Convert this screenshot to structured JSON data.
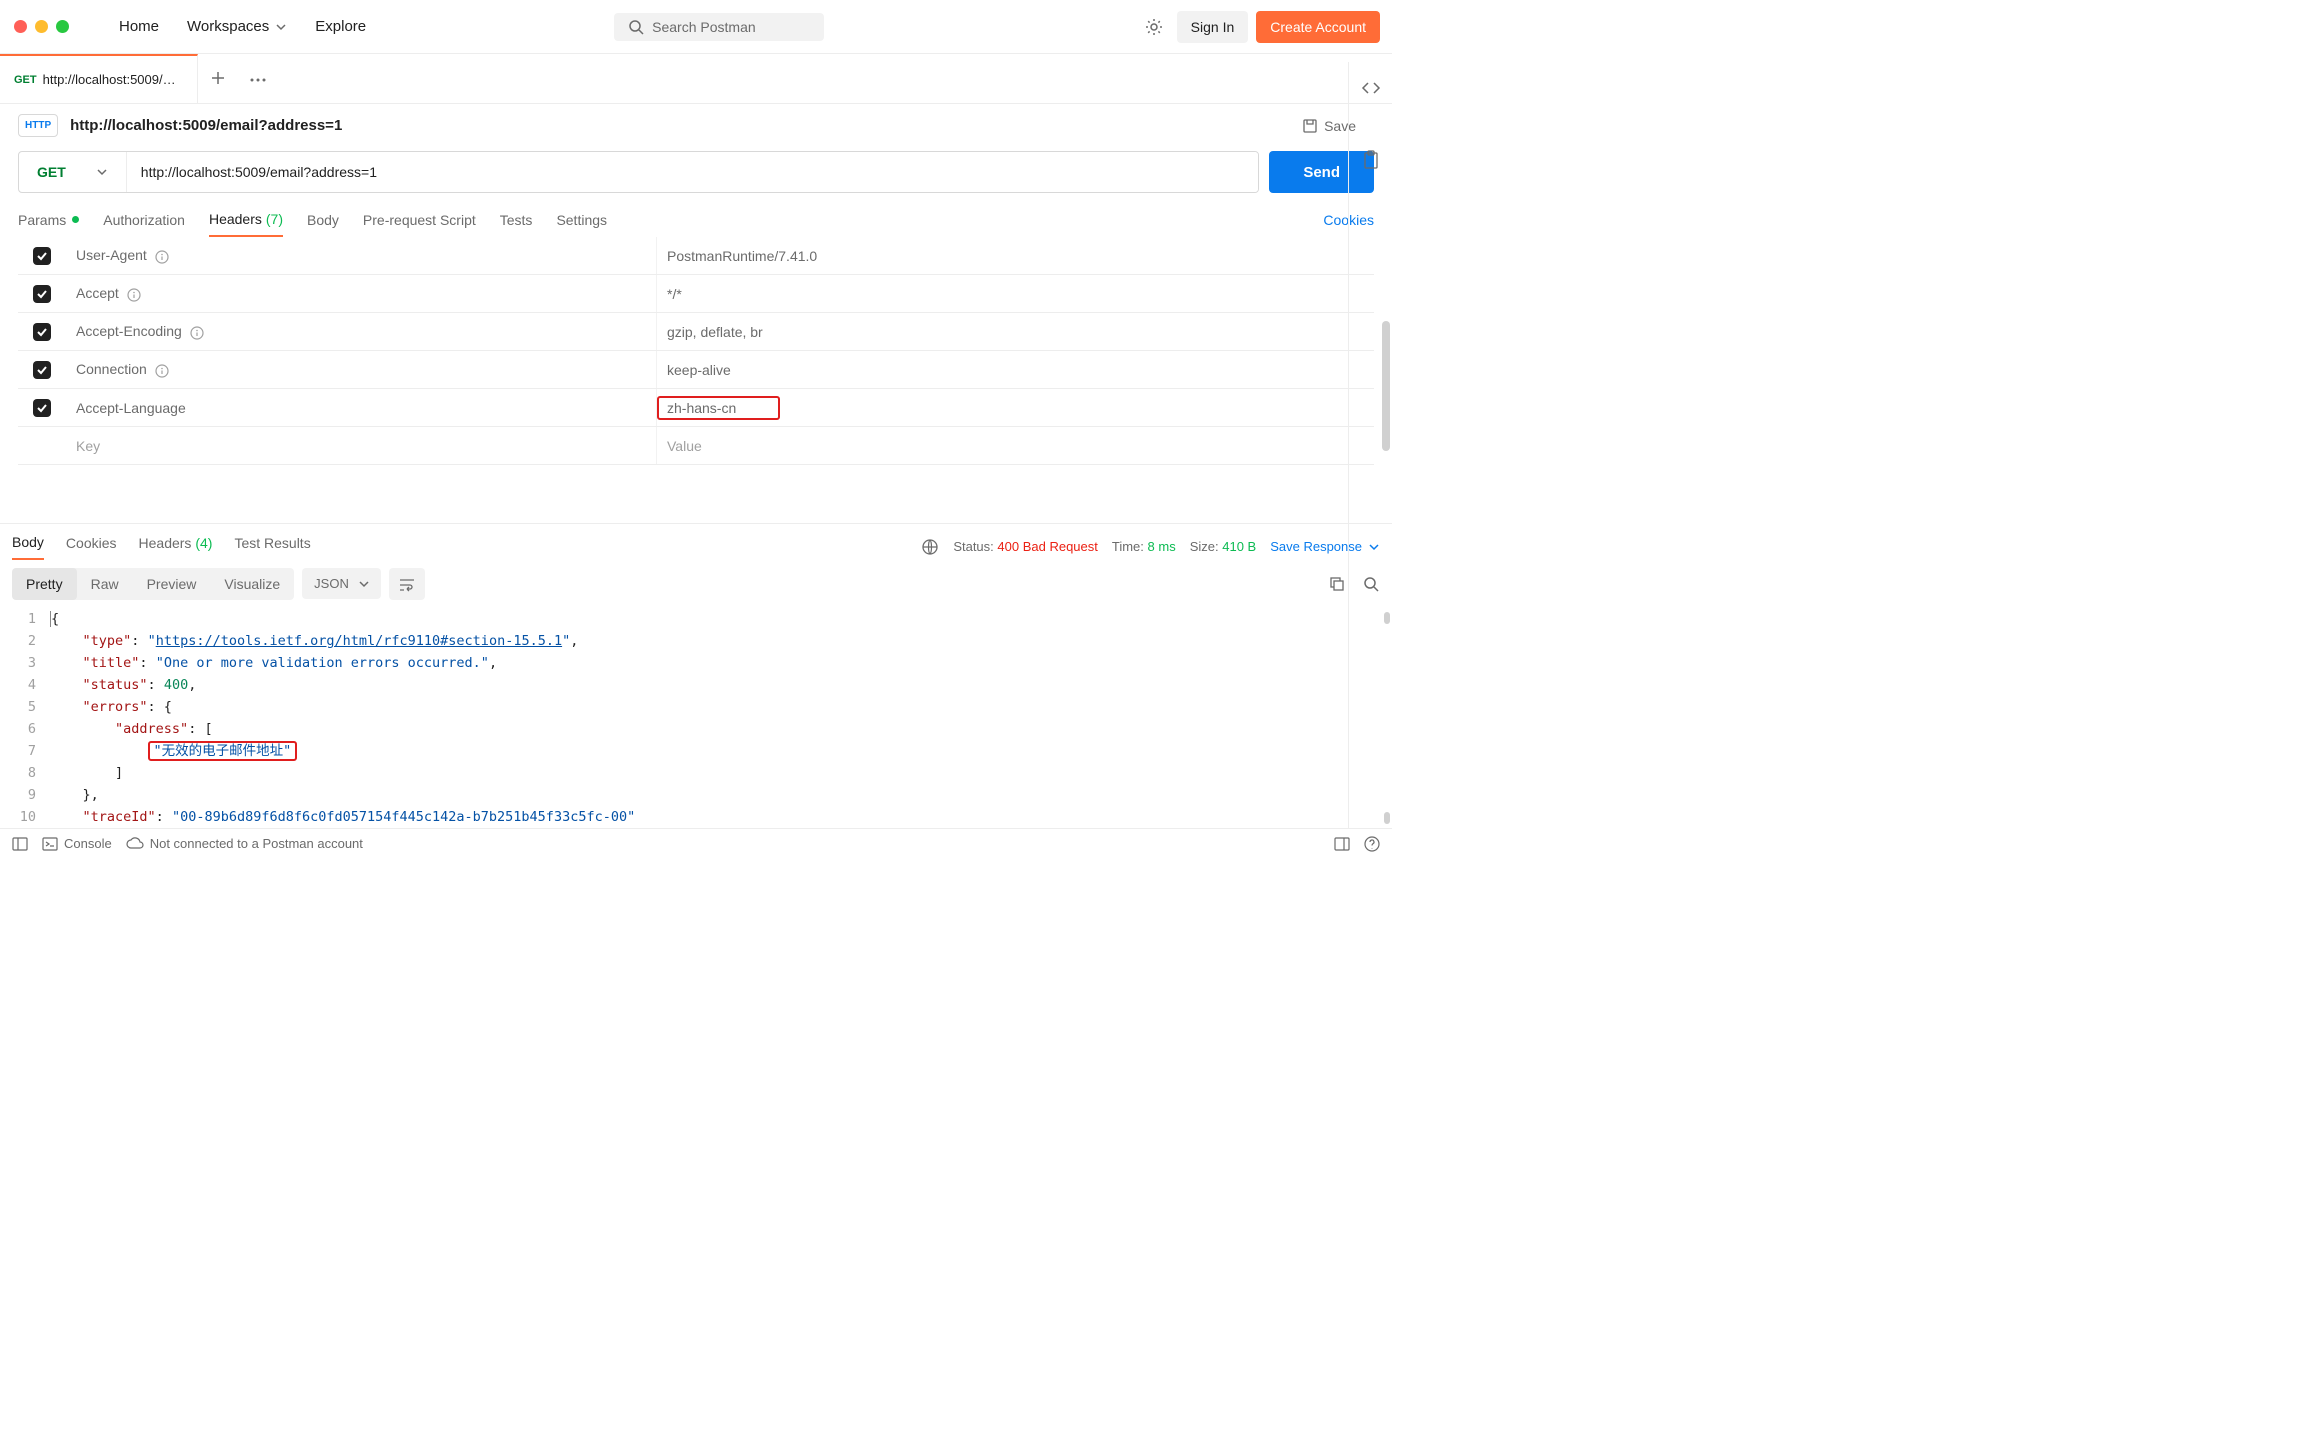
{
  "navbar": {
    "home": "Home",
    "workspaces": "Workspaces",
    "explore": "Explore",
    "search_placeholder": "Search Postman",
    "sign_in": "Sign In",
    "create_account": "Create Account"
  },
  "tab": {
    "method": "GET",
    "label": "http://localhost:5009/ema"
  },
  "request": {
    "title": "http://localhost:5009/email?address=1",
    "save": "Save",
    "method": "GET",
    "url": "http://localhost:5009/email?address=1",
    "send": "Send"
  },
  "req_tabs": {
    "params": "Params",
    "authorization": "Authorization",
    "headers": "Headers",
    "headers_count": "(7)",
    "body": "Body",
    "prerequest": "Pre-request Script",
    "tests": "Tests",
    "settings": "Settings",
    "cookies": "Cookies"
  },
  "headers": [
    {
      "key": "User-Agent",
      "value": "PostmanRuntime/7.41.0",
      "info": true
    },
    {
      "key": "Accept",
      "value": "*/*",
      "info": true
    },
    {
      "key": "Accept-Encoding",
      "value": "gzip, deflate, br",
      "info": true
    },
    {
      "key": "Connection",
      "value": "keep-alive",
      "info": true
    },
    {
      "key": "Accept-Language",
      "value": "zh-hans-cn",
      "info": false,
      "highlight": true
    }
  ],
  "header_placeholder": {
    "key": "Key",
    "value": "Value"
  },
  "response_tabs": {
    "body": "Body",
    "cookies": "Cookies",
    "headers": "Headers",
    "headers_count": "(4)",
    "test_results": "Test Results"
  },
  "response_meta": {
    "status_label": "Status:",
    "status_value": "400 Bad Request",
    "time_label": "Time:",
    "time_value": "8 ms",
    "size_label": "Size:",
    "size_value": "410 B",
    "save_response": "Save Response"
  },
  "body_view": {
    "pretty": "Pretty",
    "raw": "Raw",
    "preview": "Preview",
    "visualize": "Visualize",
    "format": "JSON"
  },
  "response_json": {
    "type": "https://tools.ietf.org/html/rfc9110#section-15.5.1",
    "title": "One or more validation errors occurred.",
    "status": 400,
    "errors": {
      "address": [
        "无效的电子邮件地址"
      ]
    },
    "traceId_key": "traceId",
    "traceId_partial": "\"00-89b6d89f6d8f6c0fd057154f445c142a-b7b251b45f33c5fc-00\""
  },
  "footer": {
    "console": "Console",
    "status": "Not connected to a Postman account"
  }
}
